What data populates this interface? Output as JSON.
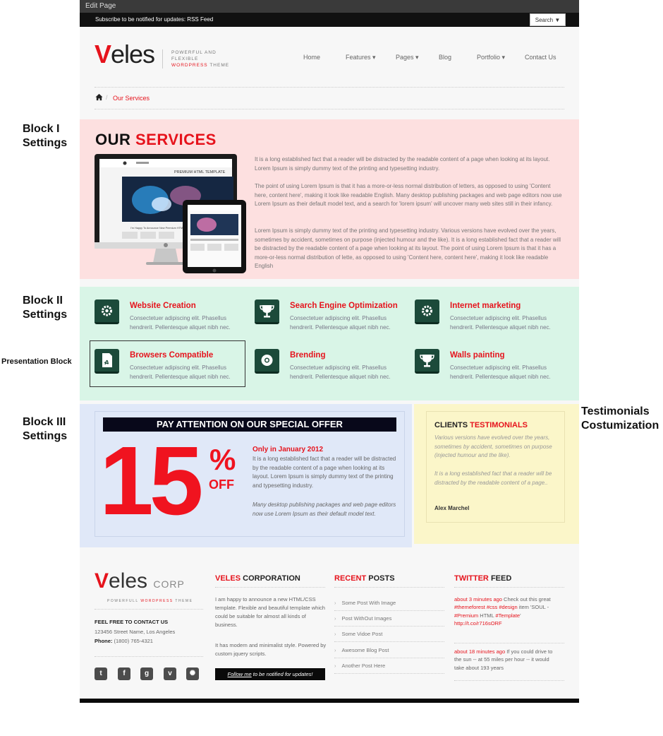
{
  "top_bar": {
    "edit_page": "Edit Page",
    "subscribe": "Subscribe to be notified for updates: RSS Feed",
    "search_button": "Search ▼"
  },
  "header": {
    "logo_v": "V",
    "logo_rest": "eles",
    "tagline_line1": "POWERFUL AND FLEXIBLE",
    "tagline_red": "WORDPRESS",
    "tagline_end": " THEME",
    "nav": [
      "Home",
      "Features ▾",
      "Pages ▾",
      "Blog",
      "Portfolio ▾",
      "Contact Us"
    ]
  },
  "breadcrumb": {
    "current": "Our Services",
    "separator": "/"
  },
  "side_labels": {
    "block1_a": "Block I",
    "block1_b": "Settings",
    "block2_a": "Block II",
    "block2_b": "Settings",
    "presentation": "Presentation Block",
    "block3_a": "Block III",
    "block3_b": "Settings",
    "testi_a": "Testimonials",
    "testi_b": "Costumization"
  },
  "services": {
    "title_black": "OUR ",
    "title_red": "SERVICES",
    "p1": "It is a long established fact that a reader will be distracted by the readable content of a page when looking at its layout. Lorem Ipsum is simply dummy text of the printing and typesetting industry.",
    "p2": "The point of using Lorem Ipsum is that it has a more-or-less normal distribution of letters, as opposed to using 'Content here, content here', making it look like readable English. Many desktop publishing packages and web page editors now use Lorem Ipsum as their default model text, and a search for 'lorem ipsum' will uncover many web sites still in their infancy.",
    "p3": "Lorem Ipsum is simply dummy text of the printing and typesetting industry. Various versions have evolved over the years, sometimes by accident, sometimes on purpose (injected humour and the like). It is a long established fact that a reader will be distracted by the readable content of a page when looking at its layout. The point of using Lorem Ipsum is that it has a more-or-less normal distribution of lette, as opposed to using 'Content here, content here', making it look like readable English",
    "mock_header": "PREMIUM HTML TEMPLATE",
    "mock_caption": "I'm Happy To Announce New Premium HTML / CSS Template"
  },
  "features": [
    {
      "title": "Website Creation",
      "line1": "Consectetuer adipiscing elit. Phasellus",
      "line2": "hendrerit. Pellentesque aliquet nibh nec.",
      "icon": "gear-icon"
    },
    {
      "title": "Search Engine Optimization",
      "line1": "Consectetuer adipiscing elit. Phasellus",
      "line2": "hendrerit. Pellentesque aliquet nibh nec.",
      "icon": "trophy-icon"
    },
    {
      "title": "Internet marketing",
      "line1": "Consectetuer adipiscing elit. Phasellus",
      "line2": "hendrerit. Pellentesque aliquet nibh nec.",
      "icon": "gear-icon"
    },
    {
      "title": "Browsers Compatible",
      "line1": "Consectetuer adipiscing elit. Phasellus",
      "line2": "hendrerit. Pellentesque aliquet nibh nec.",
      "icon": "pdf-icon"
    },
    {
      "title": "Brending",
      "line1": "Consectetuer adipiscing elit. Phasellus",
      "line2": "hendrerit. Pellentesque aliquet nibh nec.",
      "icon": "chrome-icon"
    },
    {
      "title": "Walls painting",
      "line1": "Consectetuer adipiscing elit. Phasellus",
      "line2": "hendrerit. Pellentesque aliquet nibh nec.",
      "icon": "trophy-icon"
    }
  ],
  "offer": {
    "heading": "PAY ATTENTION ON OUR SPECIAL OFFER",
    "big": "15",
    "pct": "%",
    "off": "OFF",
    "only": "Only in January 2012",
    "text1": "It is a long established fact that a reader will be distracted by the readable content of a page when looking at its layout. Lorem Ipsum is simply dummy text of the printing and typesetting industry.",
    "text2": "Many desktop publishing packages and web page editors now use Lorem Ipsum as their default model text."
  },
  "testimonials": {
    "title_black": "CLIENTS ",
    "title_red": "TESTIMONIALS",
    "q1": "Various versions have evolved over the years, sometimes by accident, sometimes on purpose (injected humour and the like).",
    "q2": "It is a long established fact that a reader will be distracted by the readable content of a page..",
    "author": "Alex Marchel"
  },
  "footer": {
    "logo_v": "V",
    "logo_rest": "eles",
    "logo_corp": "CORP",
    "tag_a": "POWERFULL ",
    "tag_red": "WORDPRESS",
    "tag_b": " THEME",
    "contact_head": "FEEL FREE TO CONTACT US",
    "address": "123456 Street Name, Los Angeles",
    "phone_label": "Phone:",
    "phone": "(1800) 765-4321",
    "social": [
      "twitter-icon",
      "facebook-icon",
      "google-icon",
      "vimeo-icon",
      "dribbble-icon"
    ],
    "social_glyphs": [
      "t",
      "f",
      "g",
      "v",
      "✺"
    ],
    "corp_red": "VELES",
    "corp_black": " CORPORATION",
    "corp_p1": "I am happy to announce a new HTML/CSS template. Flexible and beautiful template which could be suitable for almost all kinds of business.",
    "corp_p2": "It has modern and minimalist style. Powered by custom jquery scripts.",
    "follow_link": "Follow me",
    "follow_rest": " to be notified for updates!",
    "recent_red": "RECENT",
    "recent_black": " POSTS",
    "posts": [
      "Some Post With Image",
      "Post WithOut Images",
      "Some Vidoe Post",
      "Awesome Blog Post",
      "Another Post Here"
    ],
    "twitter_red": "TWITTER",
    "twitter_black": " FEED",
    "tw1_time": "about 3 minutes ago",
    "tw1_a": " Check out this great ",
    "tw1_tags": "#themeforest #css #design",
    "tw1_b": " item 'SOUL - ",
    "tw1_tags2": "#Premium",
    "tw1_c": " HTML ",
    "tw1_tags3": "#Template",
    "tw1_d": "' ",
    "tw1_link": "http://t.co/r716sORF",
    "tw2_time": "about 18 minutes ago",
    "tw2_text": " If you could drive to the sun -- at 55 miles per hour -- it would take about 193 years"
  },
  "colors": {
    "accent": "#e6131c",
    "block1": "#fde0e0",
    "block2": "#d9f5e7",
    "block3": "#e0e8f8",
    "block4": "#fbf6c9",
    "icon_bg": "#1c4a3a"
  }
}
